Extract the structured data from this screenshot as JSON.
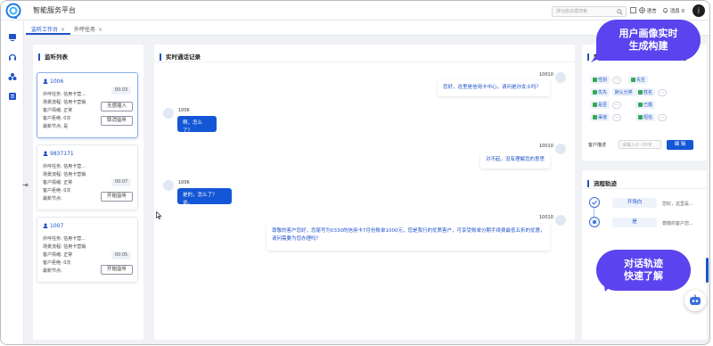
{
  "app": {
    "title": "智能服务平台",
    "search_placeholder": "搜功能关键搜索",
    "language_label": "语言",
    "messages_label": "消息",
    "messages_count": "0",
    "avatar_initial": "j"
  },
  "tabs": [
    {
      "label": "监听工作台",
      "close": "×"
    },
    {
      "label": "外呼任务",
      "close": "×"
    }
  ],
  "monitor": {
    "title": "监听列表",
    "cards": [
      {
        "id": "1006",
        "task_label": "外呼任务:",
        "task_value": "信用卡营...",
        "flow_label": "场景流程:",
        "flow_value": "信用卡营销",
        "emotion_label": "客户情绪:",
        "emotion_value": "正常",
        "reject_label": "客户拒绝:",
        "reject_value": "0次",
        "node_label": "最新节点:",
        "node_value": "是",
        "time": "00:03",
        "buttons": [
          "无感插入",
          "取消监听"
        ]
      },
      {
        "id": "9837171",
        "task_label": "外呼任务:",
        "task_value": "信用卡营...",
        "flow_label": "场景流程:",
        "flow_value": "信用卡营销",
        "emotion_label": "客户情绪:",
        "emotion_value": "正常",
        "reject_label": "客户拒绝:",
        "reject_value": "0次",
        "node_label": "最新节点:",
        "node_value": "",
        "time": "00:07",
        "buttons": [
          "开始监听"
        ]
      },
      {
        "id": "1007",
        "task_label": "外呼任务:",
        "task_value": "信用卡营...",
        "flow_label": "场景流程:",
        "flow_value": "信用卡营销",
        "emotion_label": "客户情绪:",
        "emotion_value": "正常",
        "reject_label": "客户拒绝:",
        "reject_value": "0次",
        "node_label": "最新节点:",
        "node_value": "",
        "time": "00:05",
        "buttons": [
          "开始监听"
        ]
      }
    ]
  },
  "chat": {
    "title": "实时通话记录",
    "messages": [
      {
        "side": "right",
        "speaker": "10010",
        "text": "您好，这里是信用卡中心。请问是孙女士吗？"
      },
      {
        "side": "left",
        "speaker": "1006",
        "text": "啊，怎么了？"
      },
      {
        "side": "right",
        "speaker": "10010",
        "text": "对不起，没有理解您的意思"
      },
      {
        "side": "left",
        "speaker": "1006",
        "text": "是的，怎么了？说。"
      },
      {
        "side": "right",
        "speaker": "10010",
        "line1": "尊敬的客户您好，您尾号为0330的信用卡7月份账单1000元，您是我行的优质客户，可享受账单分期手续费最低五折的优惠，",
        "line2": "请问需要为您办理吗？"
      }
    ]
  },
  "profile": {
    "title": "客户画像",
    "tags": [
      [
        "性别",
        "先生"
      ],
      [
        "优先",
        "默认分类"
      ],
      [
        "姓名",
        "主键"
      ],
      [
        "已婚",
        "是否"
      ],
      [
        "渠道",
        "短信"
      ]
    ],
    "desc_label": "客户描述",
    "desc_placeholder": "请输入0~30字",
    "edit_button": "编 辑"
  },
  "flow": {
    "title": "流程轨迹",
    "steps": [
      {
        "name": "开场白",
        "desc": "您好，这里是..."
      },
      {
        "name": "是",
        "desc": "尊敬的客户您..."
      }
    ]
  },
  "callouts": {
    "top": [
      "用户画像实时",
      "生成构建"
    ],
    "bottom": [
      "对话轨迹",
      "快速了解"
    ]
  },
  "colors": {
    "primary": "#1e52c9",
    "callout": "#5b43f0",
    "agent_bubble": "#1457d6"
  }
}
